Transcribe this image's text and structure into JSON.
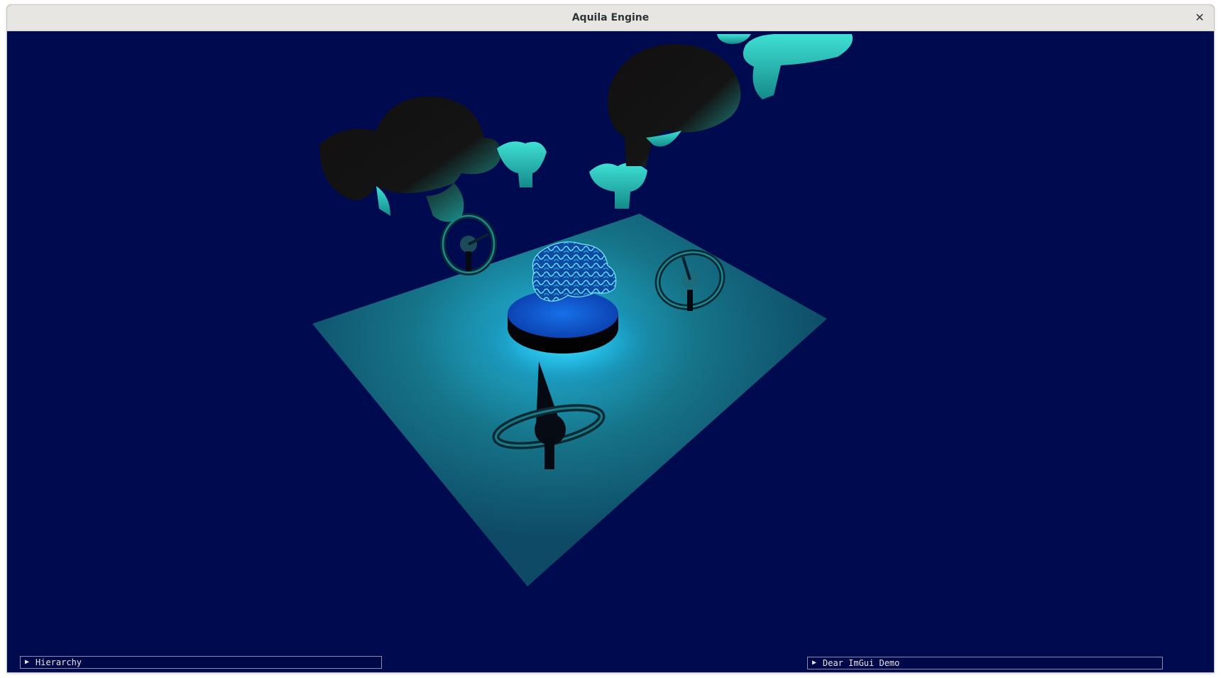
{
  "window": {
    "title": "Aquila Engine",
    "close_glyph": "✕"
  },
  "viewport": {
    "clear_color": "#000a4e",
    "floor_color": "#1a8aa0",
    "glow_color": "#20d8ff",
    "mesh_color": "#2cc8c8"
  },
  "panels": {
    "hierarchy": {
      "arrow": "▶",
      "label": "Hierarchy"
    },
    "demo": {
      "arrow": "▶",
      "label": "Dear ImGui Demo"
    }
  }
}
